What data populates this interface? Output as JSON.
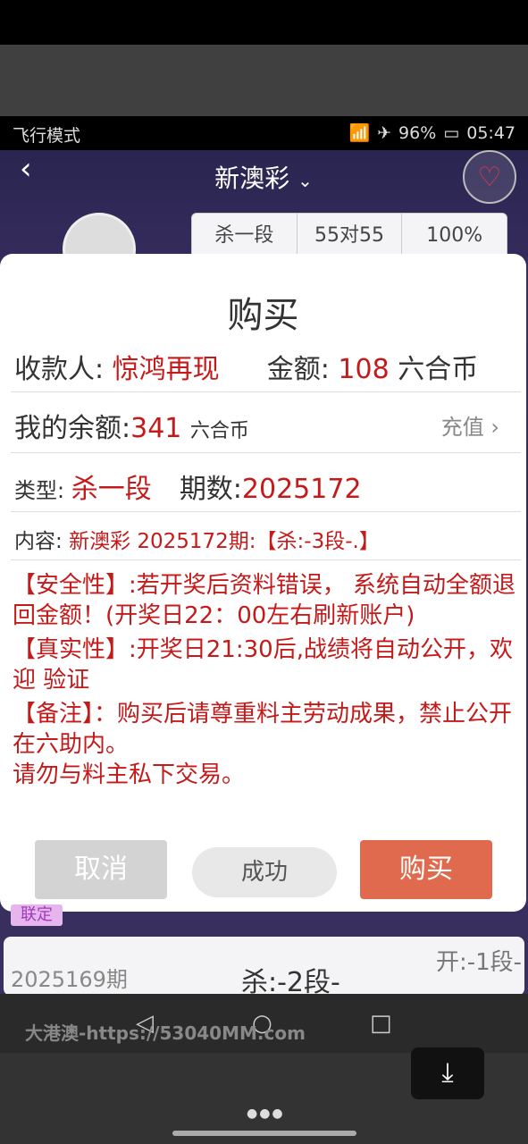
{
  "status_bar": {
    "left_text": "飞行模式",
    "battery": "96%",
    "time": "05:47"
  },
  "app": {
    "title": "新澳彩",
    "back_icon": "chevron-left-icon",
    "fav_icon": "heart-icon"
  },
  "stats": [
    "杀一段",
    "55对55",
    "100%"
  ],
  "modal": {
    "title": "购买",
    "payee_label": "收款人: ",
    "payee_value": "惊鸿再现",
    "amount_label": "金额: ",
    "amount_value": "108",
    "amount_unit": " 六合币",
    "balance_label": "我的余额:",
    "balance_value": "341",
    "balance_unit": "六合币",
    "recharge": "充值 ›",
    "type_label": "类型: ",
    "type_value": "杀一段",
    "period_label": "期数:",
    "period_value": "2025172",
    "content_label": "内容: ",
    "content_value": "新澳彩 2025172期:【杀:-3段-.】",
    "notices": [
      "【安全性】:若开奖后资料错误， 系统自动全额退回金额！(开奖日22：00左右刷新账户)",
      "【真实性】:开奖日21:30后,战绩将自动公开，欢迎 验证",
      "【备注】：购买后请尊重料主劳动成果，禁止公开在六助内。\n请勿与料主私下交易。"
    ],
    "buttons": {
      "cancel": "取消",
      "success": "成功",
      "buy": "购买"
    }
  },
  "list": {
    "badge": "联定",
    "period": "2025169期",
    "kill": "杀:-2段-",
    "open": "开:-1段-"
  },
  "watermark": "大港澳-https://53040MM.com",
  "colors": {
    "accent_red": "#c41a1a",
    "buy_button": "#e06a4e",
    "header_bg": "#2e2a55"
  }
}
